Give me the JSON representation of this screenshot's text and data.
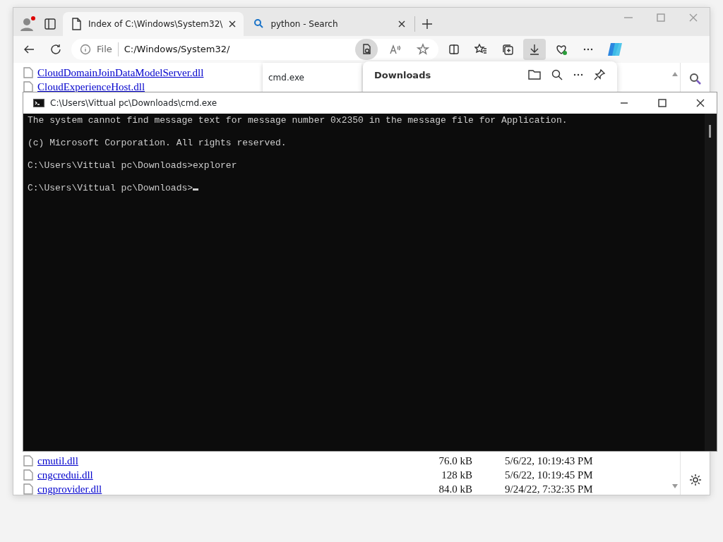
{
  "browser": {
    "tabs": [
      {
        "title": "Index of C:\\Windows\\System32\\",
        "kind": "page",
        "selected": true
      },
      {
        "title": "python - Search",
        "kind": "search",
        "selected": false
      }
    ],
    "address": {
      "scheme": "File",
      "url": "C:/Windows/System32/"
    },
    "toolbar_buttons": [
      {
        "kind": "immersive-reader",
        "selected": true
      },
      {
        "kind": "read-aloud",
        "selected": false
      },
      {
        "kind": "favorite",
        "selected": false
      },
      {
        "kind": "split",
        "selected": false
      },
      {
        "kind": "favorites",
        "selected": false
      },
      {
        "kind": "collections",
        "selected": false
      },
      {
        "kind": "downloads",
        "selected": true
      },
      {
        "kind": "health",
        "selected": false
      },
      {
        "kind": "more",
        "selected": false
      }
    ],
    "files_top": [
      {
        "name": "CloudDomainJoinDataModelServer.dll"
      },
      {
        "name": "CloudExperienceHost.dll"
      }
    ],
    "files_bottom": [
      {
        "name": "cmutil.dll",
        "size": "76.0 kB",
        "date": "5/6/22, 10:19:43 PM"
      },
      {
        "name": "cngcredui.dll",
        "size": "128 kB",
        "date": "5/6/22, 10:19:45 PM"
      },
      {
        "name": "cngprovider.dll",
        "size": "84.0 kB",
        "date": "9/24/22, 7:32:35 PM"
      }
    ],
    "tooltip": "cmd.exe",
    "downloads_panel": {
      "title": "Downloads"
    }
  },
  "console": {
    "title": "C:\\Users\\Vittual pc\\Downloads\\cmd.exe",
    "lines": [
      {
        "text": "The system cannot find message text for message number 0x2350 in the message file for Application.",
        "cursor": false
      },
      {
        "text": "(c) Microsoft Corporation. All rights reserved.",
        "cursor": false
      },
      {
        "text": "C:\\Users\\Vittual pc\\Downloads>explorer",
        "cursor": false
      },
      {
        "text": "C:\\Users\\Vittual pc\\Downloads>",
        "cursor": true
      }
    ]
  }
}
